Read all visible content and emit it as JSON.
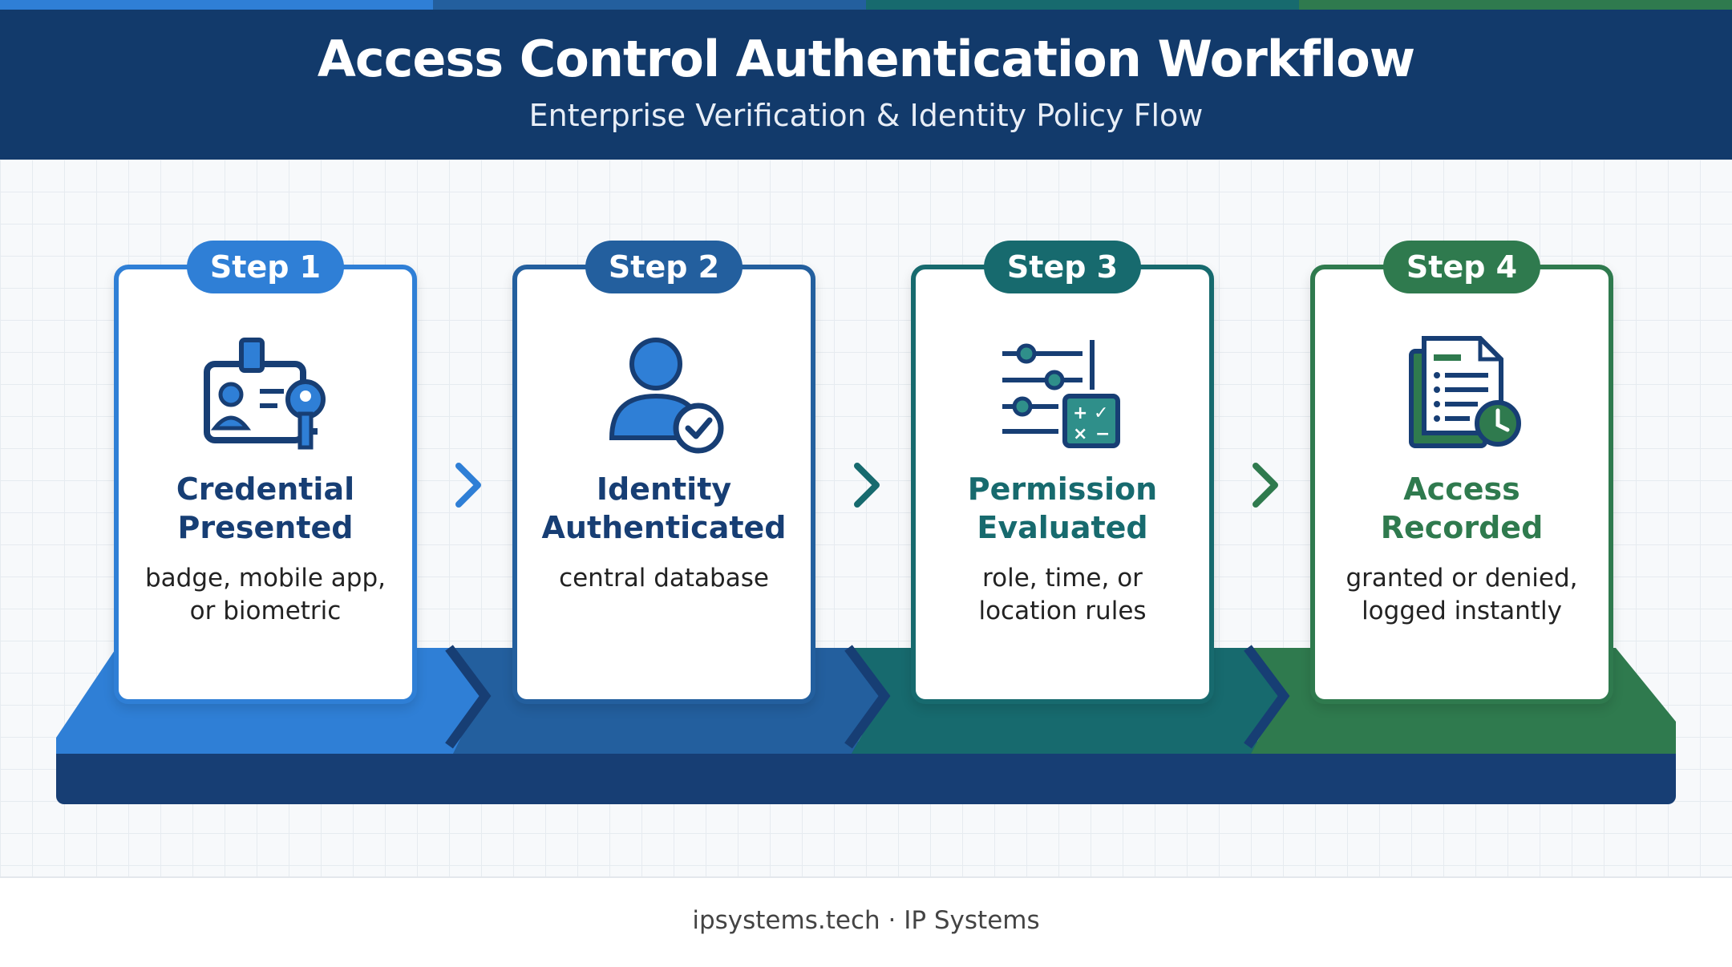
{
  "header": {
    "title": "Access Control Authentication Workflow",
    "subtitle": "Enterprise Verification & Identity Policy Flow"
  },
  "colors": {
    "navy": "#123a6b",
    "step1": "#2f7fd6",
    "step2": "#235f9e",
    "step3": "#176a6e",
    "step4": "#2f7a4e"
  },
  "steps": [
    {
      "badge": "Step 1",
      "title_line1": "Credential",
      "title_line2": "Presented",
      "desc_line1": "badge, mobile app,",
      "desc_line2": "or biometric",
      "icon": "id-badge-key-icon"
    },
    {
      "badge": "Step 2",
      "title_line1": "Identity",
      "title_line2": "Authenticated",
      "desc_line1": "central database",
      "desc_line2": "",
      "icon": "user-check-icon"
    },
    {
      "badge": "Step 3",
      "title_line1": "Permission",
      "title_line2": "Evaluated",
      "desc_line1": "role, time, or",
      "desc_line2": "location rules",
      "icon": "sliders-calculator-icon"
    },
    {
      "badge": "Step 4",
      "title_line1": "Access",
      "title_line2": "Recorded",
      "desc_line1": "granted or denied,",
      "desc_line2": "logged instantly",
      "icon": "document-clock-icon"
    }
  ],
  "footer": {
    "text": "ipsystems.tech · IP Systems"
  }
}
